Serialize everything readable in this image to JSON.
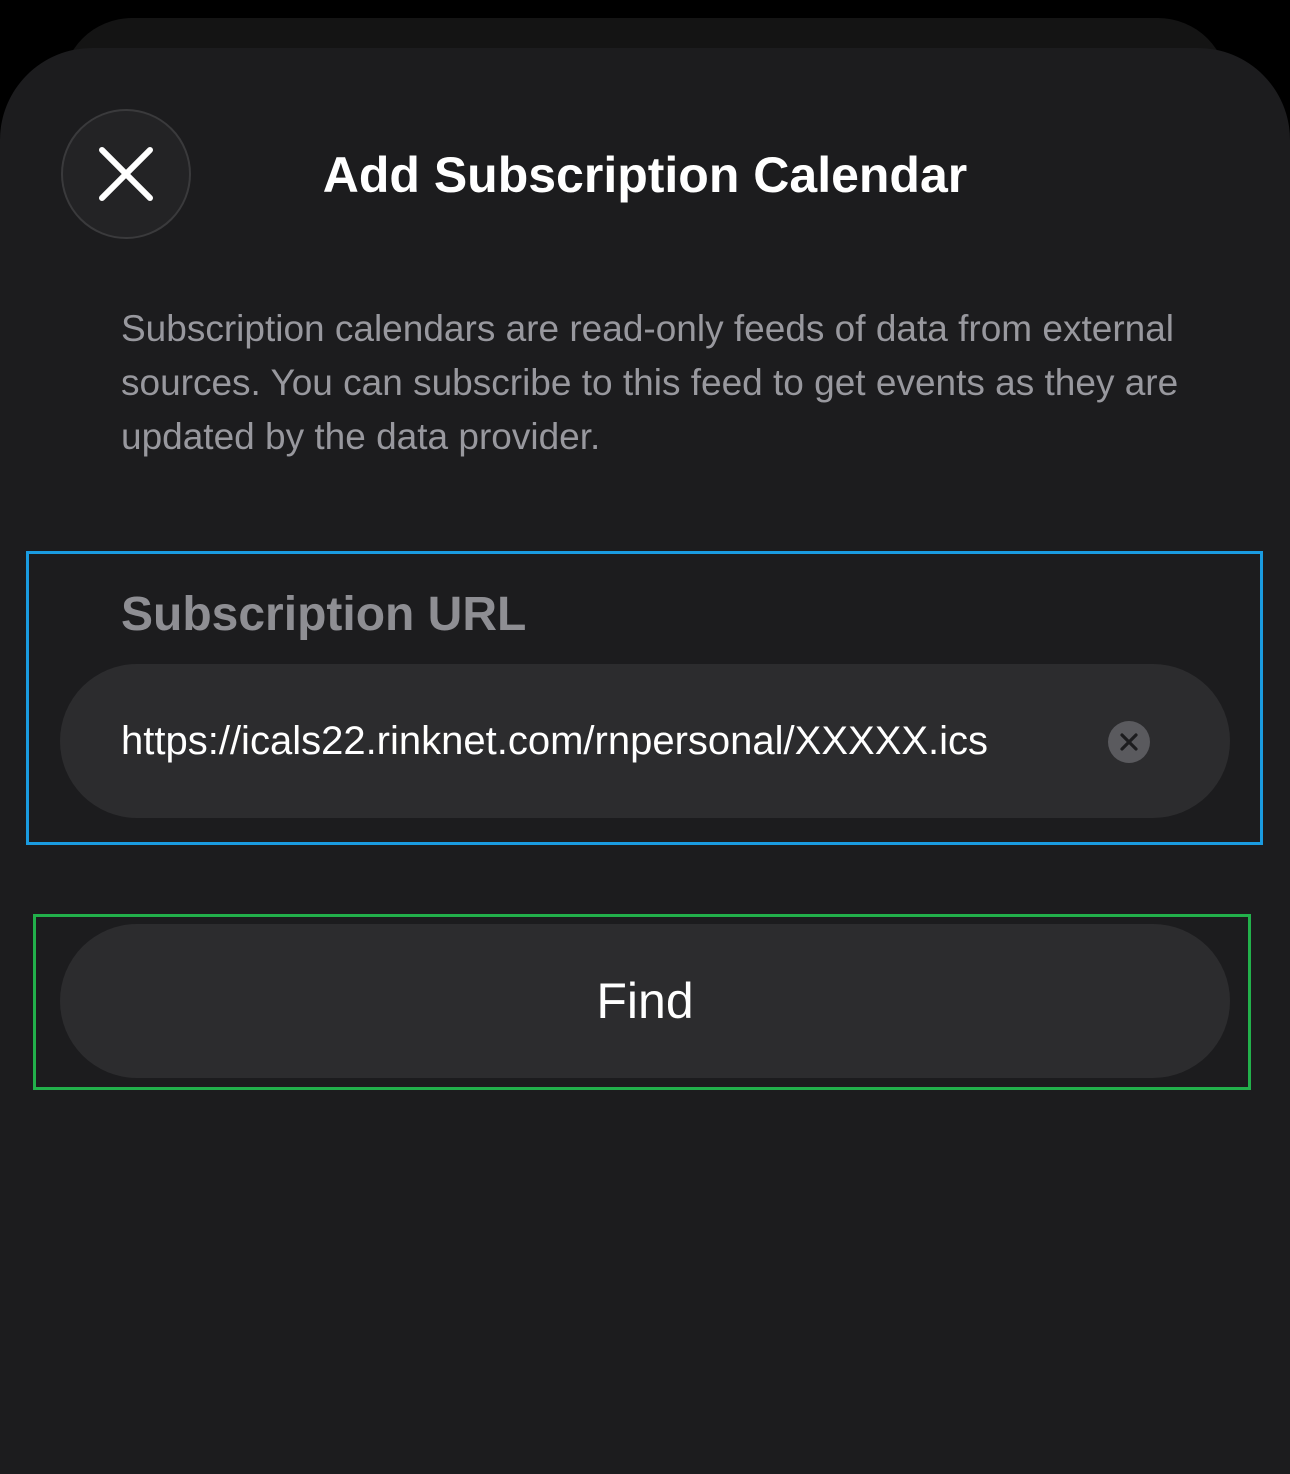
{
  "header": {
    "title": "Add Subscription Calendar",
    "close_icon": "close-x-icon"
  },
  "description": "Subscription calendars are read-only feeds of data from external sources. You can subscribe to this feed to get events as they are updated by the data provider.",
  "subscription_url": {
    "label": "Subscription URL",
    "value": "https://icals22.rinknet.com/rnpersonal/XXXXX.ics",
    "clear_icon": "clear-circle-x-icon"
  },
  "actions": {
    "find_label": "Find"
  },
  "colors": {
    "background": "#000000",
    "sheet": "#1c1c1e",
    "control_fill": "#2c2c2e",
    "secondary_text": "#98989e",
    "highlight_blue": "#1a9be0",
    "highlight_green": "#22b04b"
  }
}
